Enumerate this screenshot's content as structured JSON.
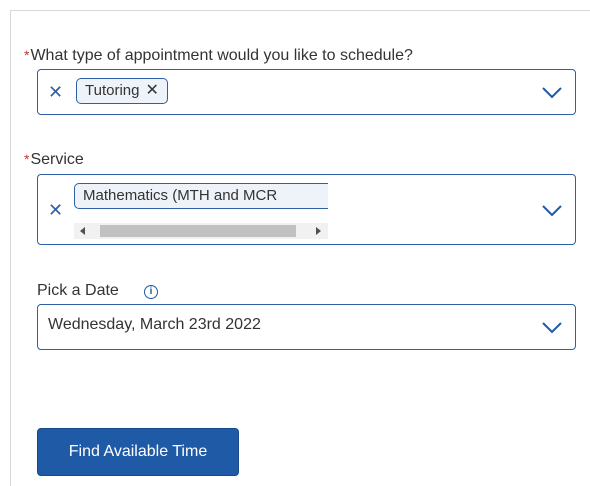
{
  "colors": {
    "accent": "#1f5aa6",
    "required": "#c0392b",
    "chip_bg": "#eef3fa"
  },
  "appointment_type": {
    "required_marker": "*",
    "label": "What type of appointment would you like to schedule?",
    "selected_chip": "Tutoring",
    "chip_remove_glyph": "✕",
    "clear_glyph": "✕"
  },
  "service": {
    "required_marker": "*",
    "label": "Service",
    "selected_chip": "Mathematics (MTH and MCR",
    "clear_glyph": "✕"
  },
  "date": {
    "label": "Pick a Date",
    "info_glyph": "i",
    "value": "Wednesday, March 23rd 2022"
  },
  "actions": {
    "find_button": "Find Available Time"
  }
}
